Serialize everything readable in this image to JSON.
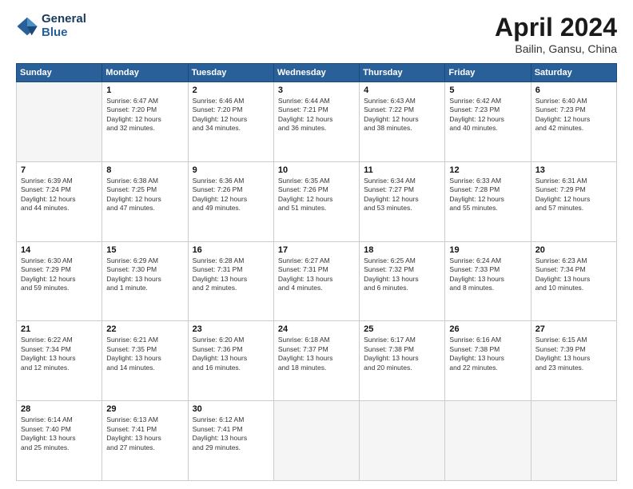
{
  "header": {
    "logo_line1": "General",
    "logo_line2": "Blue",
    "month": "April 2024",
    "location": "Bailin, Gansu, China"
  },
  "weekdays": [
    "Sunday",
    "Monday",
    "Tuesday",
    "Wednesday",
    "Thursday",
    "Friday",
    "Saturday"
  ],
  "weeks": [
    [
      {
        "day": "",
        "info": ""
      },
      {
        "day": "1",
        "info": "Sunrise: 6:47 AM\nSunset: 7:20 PM\nDaylight: 12 hours\nand 32 minutes."
      },
      {
        "day": "2",
        "info": "Sunrise: 6:46 AM\nSunset: 7:20 PM\nDaylight: 12 hours\nand 34 minutes."
      },
      {
        "day": "3",
        "info": "Sunrise: 6:44 AM\nSunset: 7:21 PM\nDaylight: 12 hours\nand 36 minutes."
      },
      {
        "day": "4",
        "info": "Sunrise: 6:43 AM\nSunset: 7:22 PM\nDaylight: 12 hours\nand 38 minutes."
      },
      {
        "day": "5",
        "info": "Sunrise: 6:42 AM\nSunset: 7:23 PM\nDaylight: 12 hours\nand 40 minutes."
      },
      {
        "day": "6",
        "info": "Sunrise: 6:40 AM\nSunset: 7:23 PM\nDaylight: 12 hours\nand 42 minutes."
      }
    ],
    [
      {
        "day": "7",
        "info": "Sunrise: 6:39 AM\nSunset: 7:24 PM\nDaylight: 12 hours\nand 44 minutes."
      },
      {
        "day": "8",
        "info": "Sunrise: 6:38 AM\nSunset: 7:25 PM\nDaylight: 12 hours\nand 47 minutes."
      },
      {
        "day": "9",
        "info": "Sunrise: 6:36 AM\nSunset: 7:26 PM\nDaylight: 12 hours\nand 49 minutes."
      },
      {
        "day": "10",
        "info": "Sunrise: 6:35 AM\nSunset: 7:26 PM\nDaylight: 12 hours\nand 51 minutes."
      },
      {
        "day": "11",
        "info": "Sunrise: 6:34 AM\nSunset: 7:27 PM\nDaylight: 12 hours\nand 53 minutes."
      },
      {
        "day": "12",
        "info": "Sunrise: 6:33 AM\nSunset: 7:28 PM\nDaylight: 12 hours\nand 55 minutes."
      },
      {
        "day": "13",
        "info": "Sunrise: 6:31 AM\nSunset: 7:29 PM\nDaylight: 12 hours\nand 57 minutes."
      }
    ],
    [
      {
        "day": "14",
        "info": "Sunrise: 6:30 AM\nSunset: 7:29 PM\nDaylight: 12 hours\nand 59 minutes."
      },
      {
        "day": "15",
        "info": "Sunrise: 6:29 AM\nSunset: 7:30 PM\nDaylight: 13 hours\nand 1 minute."
      },
      {
        "day": "16",
        "info": "Sunrise: 6:28 AM\nSunset: 7:31 PM\nDaylight: 13 hours\nand 2 minutes."
      },
      {
        "day": "17",
        "info": "Sunrise: 6:27 AM\nSunset: 7:31 PM\nDaylight: 13 hours\nand 4 minutes."
      },
      {
        "day": "18",
        "info": "Sunrise: 6:25 AM\nSunset: 7:32 PM\nDaylight: 13 hours\nand 6 minutes."
      },
      {
        "day": "19",
        "info": "Sunrise: 6:24 AM\nSunset: 7:33 PM\nDaylight: 13 hours\nand 8 minutes."
      },
      {
        "day": "20",
        "info": "Sunrise: 6:23 AM\nSunset: 7:34 PM\nDaylight: 13 hours\nand 10 minutes."
      }
    ],
    [
      {
        "day": "21",
        "info": "Sunrise: 6:22 AM\nSunset: 7:34 PM\nDaylight: 13 hours\nand 12 minutes."
      },
      {
        "day": "22",
        "info": "Sunrise: 6:21 AM\nSunset: 7:35 PM\nDaylight: 13 hours\nand 14 minutes."
      },
      {
        "day": "23",
        "info": "Sunrise: 6:20 AM\nSunset: 7:36 PM\nDaylight: 13 hours\nand 16 minutes."
      },
      {
        "day": "24",
        "info": "Sunrise: 6:18 AM\nSunset: 7:37 PM\nDaylight: 13 hours\nand 18 minutes."
      },
      {
        "day": "25",
        "info": "Sunrise: 6:17 AM\nSunset: 7:38 PM\nDaylight: 13 hours\nand 20 minutes."
      },
      {
        "day": "26",
        "info": "Sunrise: 6:16 AM\nSunset: 7:38 PM\nDaylight: 13 hours\nand 22 minutes."
      },
      {
        "day": "27",
        "info": "Sunrise: 6:15 AM\nSunset: 7:39 PM\nDaylight: 13 hours\nand 23 minutes."
      }
    ],
    [
      {
        "day": "28",
        "info": "Sunrise: 6:14 AM\nSunset: 7:40 PM\nDaylight: 13 hours\nand 25 minutes."
      },
      {
        "day": "29",
        "info": "Sunrise: 6:13 AM\nSunset: 7:41 PM\nDaylight: 13 hours\nand 27 minutes."
      },
      {
        "day": "30",
        "info": "Sunrise: 6:12 AM\nSunset: 7:41 PM\nDaylight: 13 hours\nand 29 minutes."
      },
      {
        "day": "",
        "info": ""
      },
      {
        "day": "",
        "info": ""
      },
      {
        "day": "",
        "info": ""
      },
      {
        "day": "",
        "info": ""
      }
    ]
  ]
}
